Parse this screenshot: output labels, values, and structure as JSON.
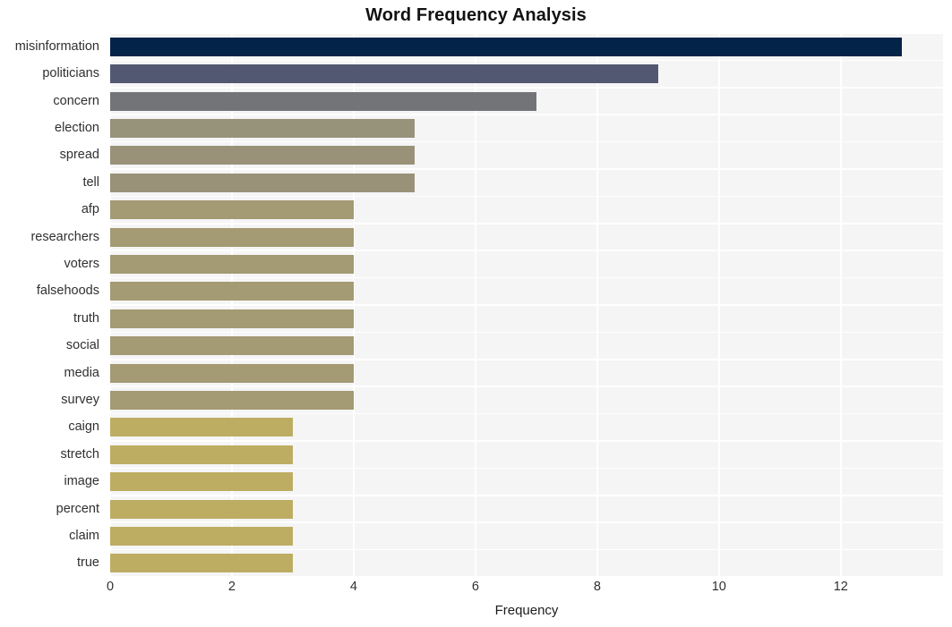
{
  "chart_data": {
    "type": "bar",
    "orientation": "horizontal",
    "title": "Word Frequency Analysis",
    "xlabel": "Frequency",
    "ylabel": "",
    "categories": [
      "misinformation",
      "politicians",
      "concern",
      "election",
      "spread",
      "tell",
      "afp",
      "researchers",
      "voters",
      "falsehoods",
      "truth",
      "social",
      "media",
      "survey",
      "caign",
      "stretch",
      "image",
      "percent",
      "claim",
      "true"
    ],
    "values": [
      13,
      9,
      7,
      5,
      5,
      5,
      4,
      4,
      4,
      4,
      4,
      4,
      4,
      4,
      3,
      3,
      3,
      3,
      3,
      3
    ],
    "bar_colors": [
      "#042349",
      "#535872",
      "#737478",
      "#97927a",
      "#999279",
      "#999279",
      "#a49a73",
      "#a49a73",
      "#a49a73",
      "#a49a73",
      "#a49a73",
      "#a49a73",
      "#a49a73",
      "#a49a73",
      "#bdad63",
      "#bdad63",
      "#bdad63",
      "#bdad63",
      "#bdad63",
      "#bdad63"
    ],
    "xticks": [
      0,
      2,
      4,
      6,
      8,
      10,
      12
    ],
    "xlim": [
      0,
      13.68
    ],
    "grid": true,
    "legend": "none",
    "panel_background": "#f5f5f6",
    "grid_color": "#ffffff"
  }
}
